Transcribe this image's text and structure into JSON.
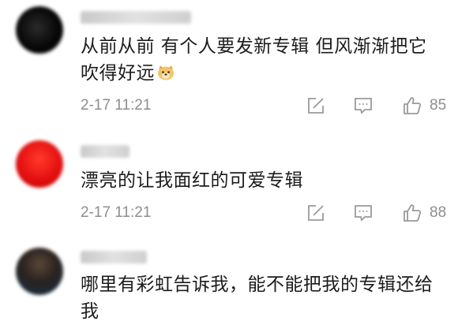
{
  "comments": [
    {
      "text_line1": "从前从前 有个人要发新专辑 但风渐渐把它",
      "text_line2": "吹得好远",
      "emoji_icon": "doge-emoji-icon",
      "time": "2-17 11:21",
      "likes": "85"
    },
    {
      "text_line1": "漂亮的让我面红的可爱专辑",
      "time": "2-17 11:21",
      "likes": "88"
    },
    {
      "text_line1": "哪里有彩虹告诉我，能不能把我的专辑还给",
      "text_line2": "我"
    }
  ],
  "icons": {
    "forward": "edit-forward-icon",
    "reply": "comment-bubble-icon",
    "like": "thumbs-up-icon"
  },
  "colors": {
    "text": "#1c1c1c",
    "meta": "#8e8e8e",
    "icon": "#9a9a9a"
  }
}
